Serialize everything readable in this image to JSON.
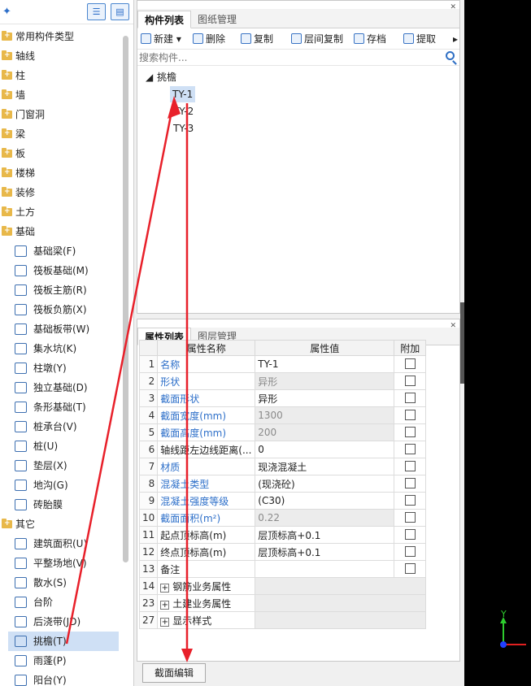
{
  "left_panel": {
    "categories": [
      {
        "label": "常用构件类型"
      },
      {
        "label": "轴线"
      },
      {
        "label": "柱"
      },
      {
        "label": "墙"
      },
      {
        "label": "门窗洞"
      },
      {
        "label": "梁"
      },
      {
        "label": "板"
      },
      {
        "label": "楼梯"
      },
      {
        "label": "装修"
      },
      {
        "label": "土方"
      }
    ],
    "foundation": {
      "label": "基础",
      "items": [
        "基础梁(F)",
        "筏板基础(M)",
        "筏板主筋(R)",
        "筏板负筋(X)",
        "基础板带(W)",
        "集水坑(K)",
        "柱墩(Y)",
        "独立基础(D)",
        "条形基础(T)",
        "桩承台(V)",
        "桩(U)",
        "垫层(X)",
        "地沟(G)",
        "砖胎膜"
      ]
    },
    "other": {
      "label": "其它",
      "items": [
        "建筑面积(U)",
        "平整场地(V)",
        "散水(S)",
        "台阶",
        "后浇带(JD)",
        "挑檐(T)",
        "雨蓬(P)",
        "阳台(Y)"
      ]
    }
  },
  "component_panel": {
    "tabs": [
      "构件列表",
      "图纸管理"
    ],
    "toolbar": [
      "新建",
      "删除",
      "复制",
      "层间复制",
      "存档",
      "提取"
    ],
    "search_placeholder": "搜索构件...",
    "group": "挑檐",
    "components": [
      "TY-1",
      "TY-2",
      "TY-3"
    ]
  },
  "property_panel": {
    "tabs": [
      "属性列表",
      "图层管理"
    ],
    "headers": [
      "属性名称",
      "属性值",
      "附加"
    ],
    "rows": [
      {
        "num": "1",
        "name": "名称",
        "value": "TY-1"
      },
      {
        "num": "2",
        "name": "形状",
        "value": "异形"
      },
      {
        "num": "3",
        "name": "截面形状",
        "value": "异形"
      },
      {
        "num": "4",
        "name": "截面宽度(mm)",
        "value": "1300"
      },
      {
        "num": "5",
        "name": "截面高度(mm)",
        "value": "200"
      },
      {
        "num": "6",
        "name": "轴线距左边线距离(...",
        "value": "0"
      },
      {
        "num": "7",
        "name": "材质",
        "value": "现浇混凝土"
      },
      {
        "num": "8",
        "name": "混凝土类型",
        "value": "(现浇砼)"
      },
      {
        "num": "9",
        "name": "混凝土强度等级",
        "value": "(C30)"
      },
      {
        "num": "10",
        "name": "截面面积(m²)",
        "value": "0.22"
      },
      {
        "num": "11",
        "name": "起点顶标高(m)",
        "value": "层顶标高+0.1"
      },
      {
        "num": "12",
        "name": "终点顶标高(m)",
        "value": "层顶标高+0.1"
      },
      {
        "num": "13",
        "name": "备注",
        "value": ""
      },
      {
        "num": "14",
        "name": "钢筋业务属性",
        "value": ""
      },
      {
        "num": "23",
        "name": "土建业务属性",
        "value": ""
      },
      {
        "num": "27",
        "name": "显示样式",
        "value": ""
      }
    ],
    "edit_button": "截面编辑"
  },
  "viewport": {
    "axis_y_label": "Y",
    "colors": {
      "y_axis": "#2ecc2e",
      "x_axis": "#e02020",
      "z_axis": "#2040ff",
      "annotation_arrow": "#e8202a"
    }
  }
}
